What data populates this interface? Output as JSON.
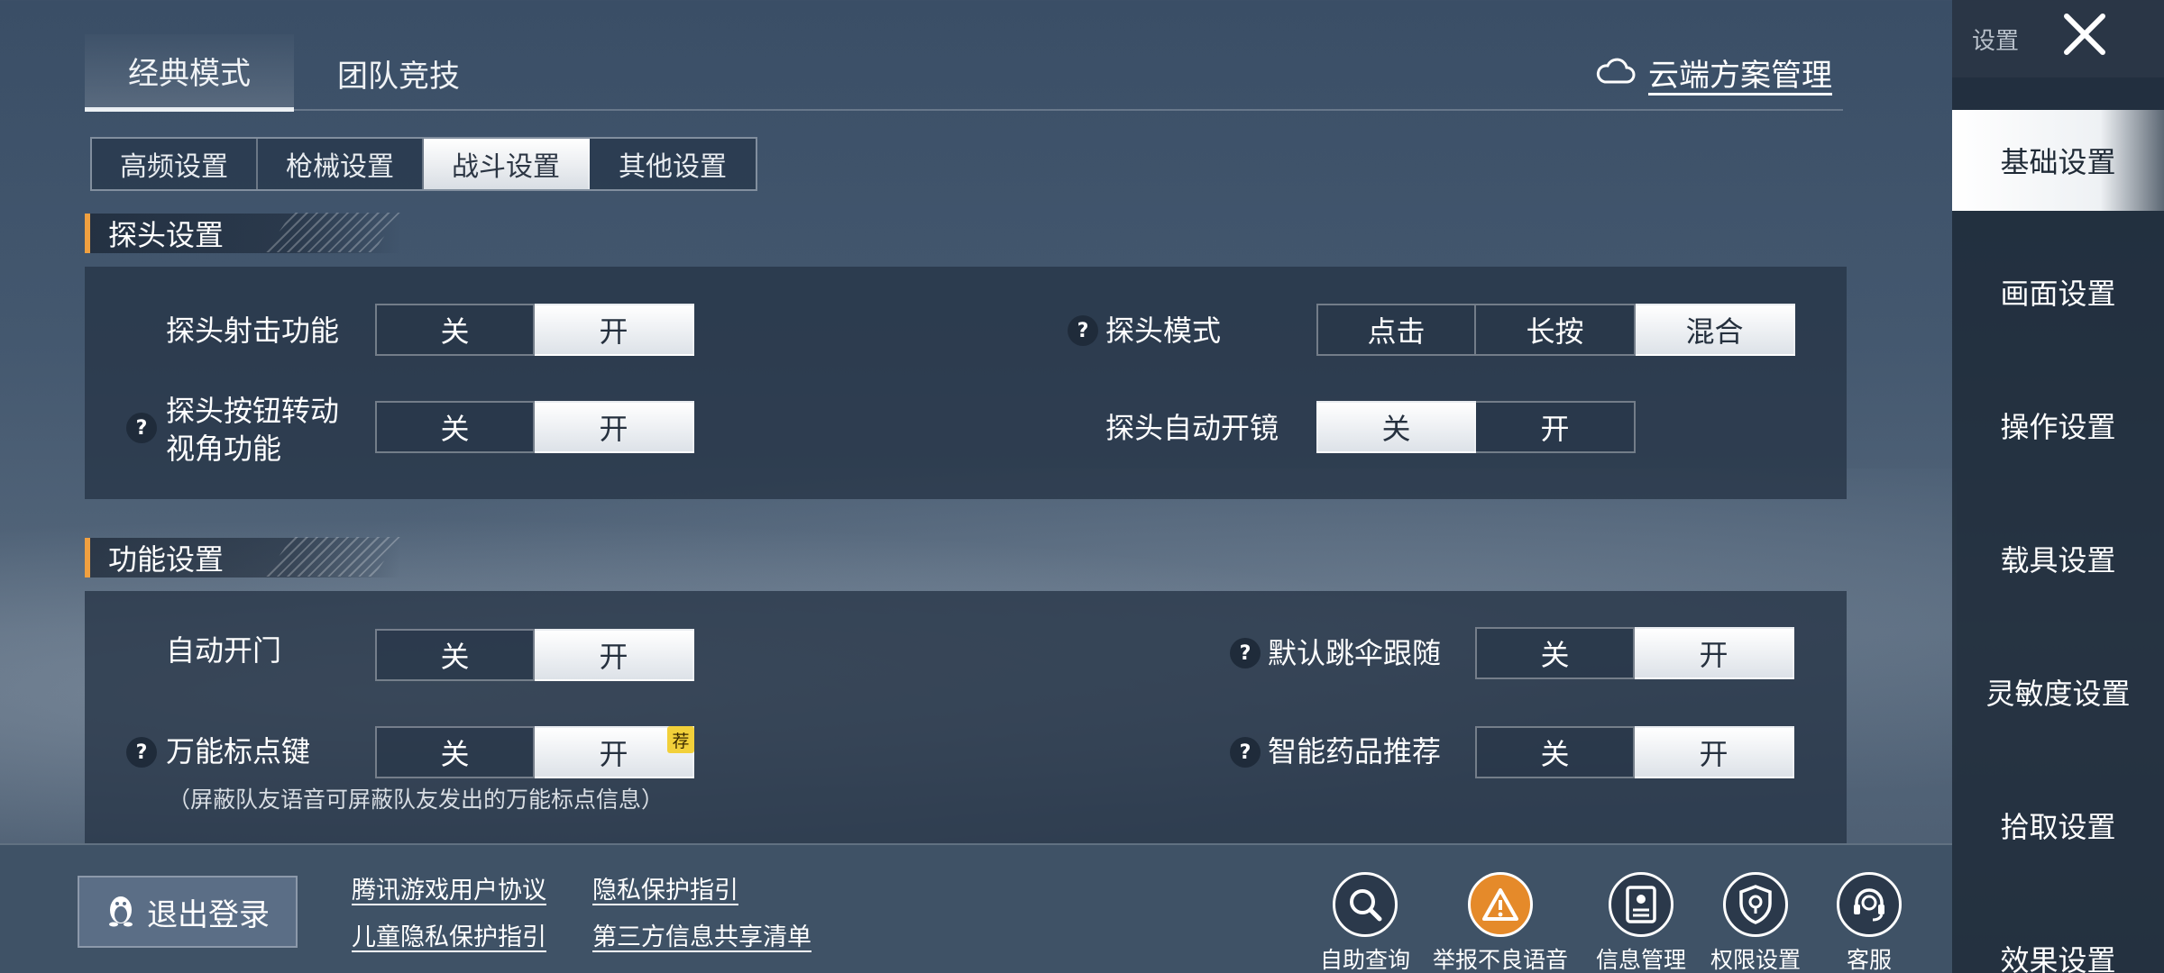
{
  "mode_tabs": [
    {
      "label": "经典模式",
      "active": true
    },
    {
      "label": "团队竞技",
      "active": false
    }
  ],
  "cloud_mgmt": {
    "label": "云端方案管理",
    "icon": "cloud-icon"
  },
  "sub_tabs": [
    {
      "label": "高频设置"
    },
    {
      "label": "枪械设置"
    },
    {
      "label": "战斗设置"
    },
    {
      "label": "其他设置"
    }
  ],
  "active_sub_tab": "战斗设置",
  "sections": {
    "peek": {
      "title": "探头设置",
      "rows": {
        "peek_fire": {
          "label": "探头射击功能",
          "options": [
            "关",
            "开"
          ],
          "selected": "开"
        },
        "peek_mode": {
          "label": "探头模式",
          "options": [
            "点击",
            "长按",
            "混合"
          ],
          "selected": "混合"
        },
        "peek_rotate": {
          "label_line1": "探头按钮转动",
          "label_line2": "视角功能",
          "options": [
            "关",
            "开"
          ],
          "selected": "开"
        },
        "peek_scope": {
          "label": "探头自动开镜",
          "options": [
            "关",
            "开"
          ],
          "selected": "关"
        }
      }
    },
    "function": {
      "title": "功能设置",
      "rows": {
        "auto_door": {
          "label": "自动开门",
          "options": [
            "关",
            "开"
          ],
          "selected": "开"
        },
        "parachute_follow": {
          "label": "默认跳伞跟随",
          "options": [
            "关",
            "开"
          ],
          "selected": "开"
        },
        "universal_marker": {
          "label": "万能标点键",
          "options": [
            "关",
            "开"
          ],
          "selected": "开",
          "badge": "荐",
          "note": "（屏蔽队友语音可屏蔽队友发出的万能标点信息）"
        },
        "smart_medicine": {
          "label": "智能药品推荐",
          "options": [
            "关",
            "开"
          ],
          "selected": "开"
        }
      }
    }
  },
  "sidebar": {
    "title": "设置",
    "items": [
      {
        "label": "基础设置",
        "active": true
      },
      {
        "label": "画面设置"
      },
      {
        "label": "操作设置"
      },
      {
        "label": "载具设置"
      },
      {
        "label": "灵敏度设置"
      },
      {
        "label": "拾取设置"
      },
      {
        "label": "效果设置"
      }
    ]
  },
  "bottom": {
    "logout_label": "退出登录",
    "links": [
      "腾讯游戏用户协议",
      "隐私保护指引",
      "儿童隐私保护指引",
      "第三方信息共享清单"
    ],
    "tools": [
      {
        "label": "自助查询",
        "icon": "search-icon"
      },
      {
        "label": "举报不良语音",
        "icon": "warning-icon"
      },
      {
        "label": "信息管理",
        "icon": "id-card-icon"
      },
      {
        "label": "权限设置",
        "icon": "shield-lock-icon"
      },
      {
        "label": "客服",
        "icon": "headset-icon"
      }
    ]
  },
  "colors": {
    "section_accent": "#f0a040",
    "badge": "#f2d03a",
    "report_icon": "#e58a2a"
  }
}
